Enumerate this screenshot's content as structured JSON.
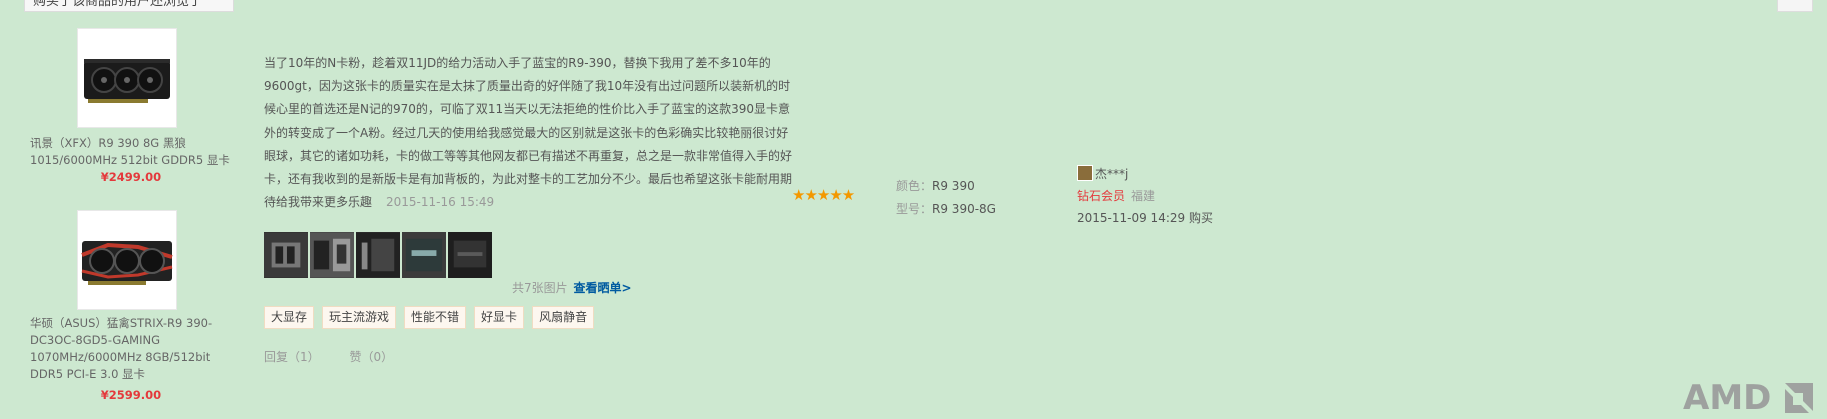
{
  "sidebar": {
    "title": "购买了该商品的用户还浏览了",
    "products": [
      {
        "name": "讯景（XFX）R9 390 8G 黑狼 1015/6000MHz 512bit GDDR5 显卡",
        "price": "¥2499.00"
      },
      {
        "name": "华硕（ASUS）猛禽STRIX-R9 390-DC3OC-8GD5-GAMING 1070MHz/6000MHz 8GB/512bit DDR5 PCI-E 3.0 显卡",
        "price": "¥2599.00"
      }
    ]
  },
  "review": {
    "text": "当了10年的N卡粉，趁着双11JD的给力活动入手了蓝宝的R9-390，替换下我用了差不多10年的9600gt，因为这张卡的质量实在是太抹了质量出奇的好伴随了我10年没有出过问题所以装新机的时候心里的首选还是N记的970的，可临了双11当天以无法拒绝的性价比入手了蓝宝的这款390显卡意外的转变成了一个A粉。经过几天的使用给我感觉最大的区别就是这张卡的色彩确实比较艳丽很讨好眼球，其它的诸如功耗，卡的做工等等其他网友都已有描述不再重复，总之是一款非常值得入手的好卡，还有我收到的是新版卡是有加背板的，为此对整卡的工艺加分不少。最后也希望这张卡能耐用期待给我带来更多乐趣",
    "date": "2015-11-16 15:49",
    "stars": "★★★★★",
    "color_label": "颜色：",
    "color_value": "R9 390",
    "model_label": "型号：",
    "model_value": "R9 390-8G",
    "buyer_name": "杰***j",
    "member_level": "钻石会员",
    "region": "福建",
    "purchase_time": "2015-11-09 14:29 购买",
    "pic_count": "共7张图片",
    "pic_link": "查看晒单>",
    "tags": [
      "大显存",
      "玩主流游戏",
      "性能不错",
      "好显卡",
      "风扇静音"
    ],
    "reply_label": "回复（1）",
    "like_label": "赞（0）"
  },
  "brand": {
    "logo_text": "AMD"
  },
  "colors": {
    "background": "#cde8d0",
    "price": "#e4393c",
    "link": "#005aa0",
    "star": "#f39800"
  }
}
